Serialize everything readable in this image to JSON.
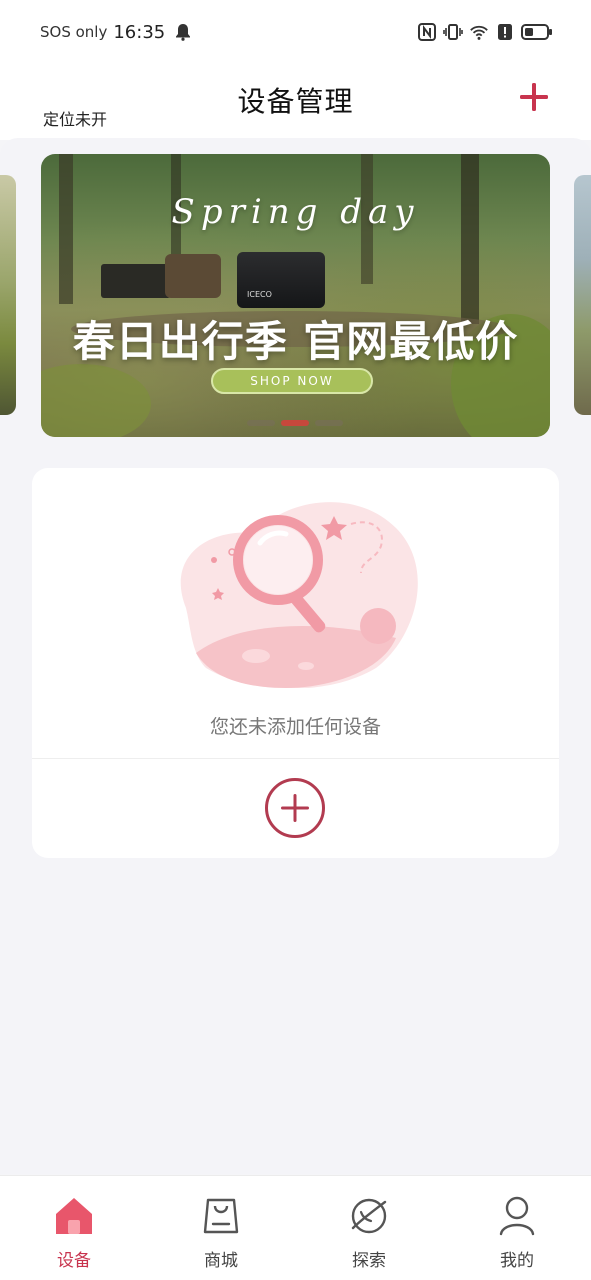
{
  "status_bar": {
    "carrier": "SOS only",
    "time": "16:35",
    "icons": [
      "bell-icon",
      "nfc-icon",
      "vibrate-icon",
      "wifi-icon",
      "alert-icon",
      "battery-icon"
    ]
  },
  "header": {
    "location": "定位未开",
    "title": "设备管理",
    "add_icon": "plus-icon"
  },
  "banner": {
    "script_text": "Spring day",
    "brand": "ICECO",
    "headline": "春日出行季 官网最低价",
    "button": "SHOP NOW",
    "slides": 3,
    "active_slide": 2
  },
  "empty_state": {
    "message": "您还未添加任何设备",
    "add_icon": "plus-circle-icon"
  },
  "tabs": [
    {
      "label": "设备",
      "icon": "home-icon",
      "active": true
    },
    {
      "label": "商城",
      "icon": "shopping-bag-icon",
      "active": false
    },
    {
      "label": "探索",
      "icon": "planet-icon",
      "active": false
    },
    {
      "label": "我的",
      "icon": "user-icon",
      "active": false
    }
  ],
  "colors": {
    "accent": "#c8344e",
    "background": "#f4f4f8",
    "card": "#ffffff"
  }
}
